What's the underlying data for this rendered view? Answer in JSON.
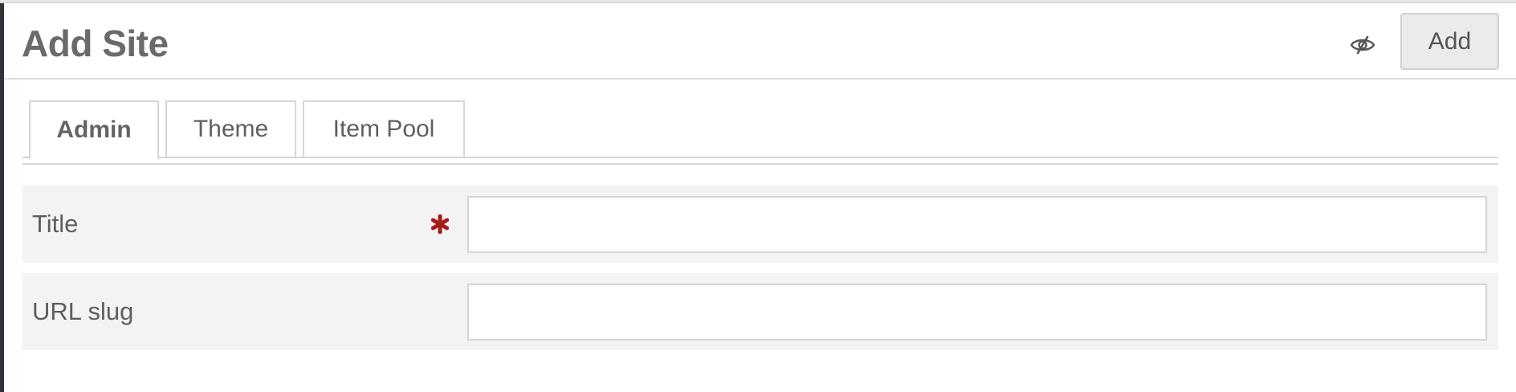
{
  "header": {
    "title": "Add Site",
    "visibility_icon": "eye-slash-icon",
    "add_label": "Add"
  },
  "tabs": [
    {
      "label": "Admin",
      "active": true
    },
    {
      "label": "Theme",
      "active": false
    },
    {
      "label": "Item Pool",
      "active": false
    }
  ],
  "form": {
    "fields": [
      {
        "label": "Title",
        "value": "",
        "required": true
      },
      {
        "label": "URL slug",
        "value": "",
        "required": false
      }
    ]
  },
  "colors": {
    "required": "#a31b1b",
    "sidebar_edge": "#2f3338",
    "row_background": "#f3f3f3"
  }
}
